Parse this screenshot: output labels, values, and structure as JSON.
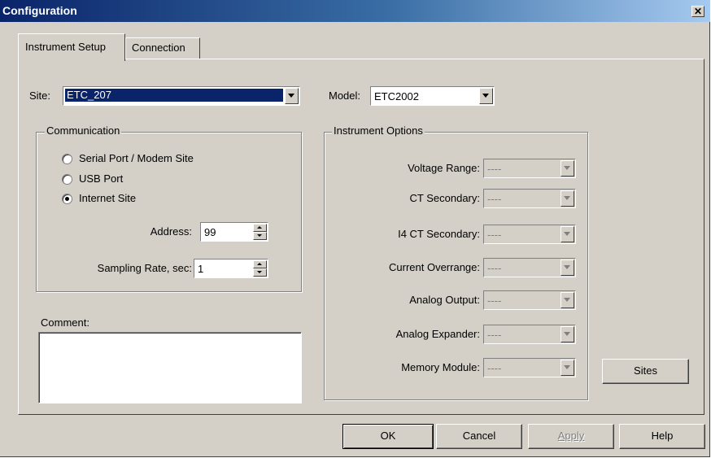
{
  "window": {
    "title": "Configuration",
    "close_glyph": "✕"
  },
  "tabs": [
    {
      "label": "Instrument Setup"
    },
    {
      "label": "Connection"
    }
  ],
  "site": {
    "label": "Site:",
    "value": "ETC_207"
  },
  "model": {
    "label": "Model:",
    "value": "ETC2002"
  },
  "communication": {
    "title": "Communication",
    "options": [
      {
        "label": "Serial Port / Modem Site",
        "selected": false
      },
      {
        "label": "USB Port",
        "selected": false
      },
      {
        "label": "Internet Site",
        "selected": true
      }
    ],
    "address_label": "Address:",
    "address_value": "99",
    "sampling_label": "Sampling Rate, sec:",
    "sampling_value": "1"
  },
  "comment": {
    "label": "Comment:",
    "value": ""
  },
  "instrument_options": {
    "title": "Instrument Options",
    "rows": [
      {
        "label": "Voltage Range:",
        "value": "----"
      },
      {
        "label": "CT Secondary:",
        "value": "----"
      },
      {
        "label": "I4 CT Secondary:",
        "value": "----"
      },
      {
        "label": "Current Overrange:",
        "value": "----"
      },
      {
        "label": "Analog Output:",
        "value": "----"
      },
      {
        "label": "Analog Expander:",
        "value": "----"
      },
      {
        "label": "Memory Module:",
        "value": "----"
      }
    ]
  },
  "buttons": {
    "sites": "Sites",
    "ok": "OK",
    "cancel": "Cancel",
    "apply": "Apply",
    "help": "Help"
  },
  "colors": {
    "title_start": "#0a246a",
    "title_end": "#a6caf0",
    "face": "#d4d0c8",
    "selection": "#0a246a"
  }
}
